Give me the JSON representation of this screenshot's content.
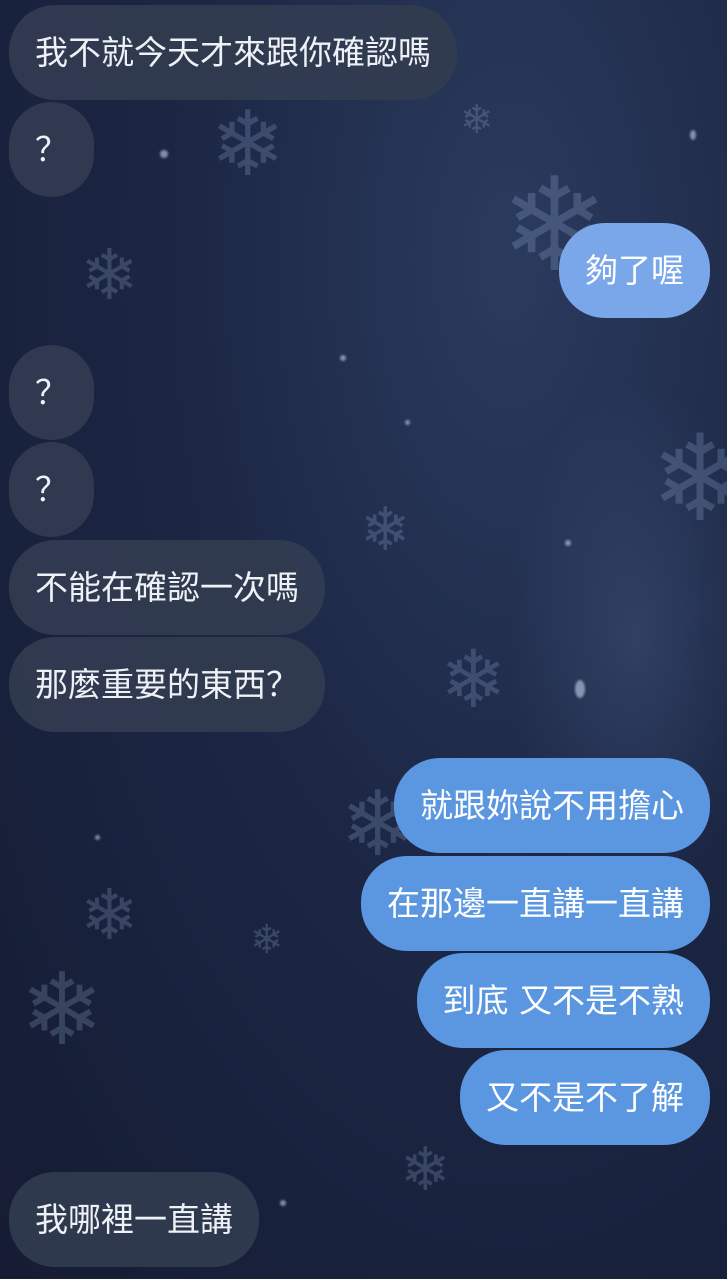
{
  "messages": [
    {
      "side": "left",
      "text": "我不就今天才來跟你確認嗎"
    },
    {
      "side": "left",
      "text": "？"
    },
    {
      "side": "right",
      "text": "夠了喔"
    },
    {
      "side": "left",
      "text": "？"
    },
    {
      "side": "left",
      "text": "？"
    },
    {
      "side": "left",
      "text": "不能在確認一次嗎"
    },
    {
      "side": "left",
      "text": "那麼重要的東西？"
    },
    {
      "side": "right",
      "text": "就跟妳說不用擔心"
    },
    {
      "side": "right",
      "text": "在那邊一直講一直講"
    },
    {
      "side": "right",
      "text": "到底 又不是不熟"
    },
    {
      "side": "right",
      "text": "又不是不了解"
    },
    {
      "side": "left",
      "text": "我哪裡一直講"
    }
  ],
  "colors": {
    "incoming_bubble": "#323c50",
    "outgoing_bubble": "#5b97e0",
    "outgoing_bubble_light": "#7aa6ea",
    "background": "#1c2745"
  },
  "background_decoration": "snowflake-icon"
}
